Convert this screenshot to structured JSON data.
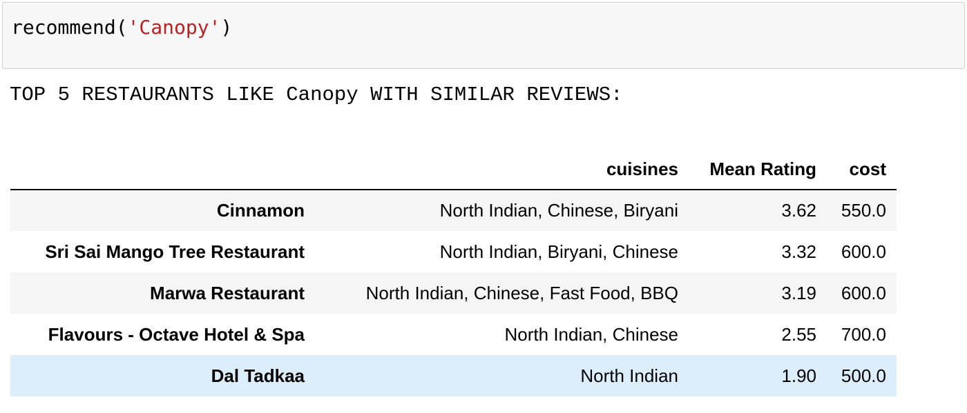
{
  "code_cell": {
    "func": "recommend(",
    "arg": "'Canopy'",
    "close": ")"
  },
  "output": {
    "heading": "TOP 5 RESTAURANTS LIKE Canopy WITH SIMILAR REVIEWS:"
  },
  "table": {
    "columns": [
      "",
      "cuisines",
      "Mean Rating",
      "cost"
    ],
    "rows": [
      {
        "name": "Cinnamon",
        "cuisines": "North Indian, Chinese, Biryani",
        "rating": "3.62",
        "cost": "550.0"
      },
      {
        "name": "Sri Sai Mango Tree Restaurant",
        "cuisines": "North Indian, Biryani, Chinese",
        "rating": "3.32",
        "cost": "600.0"
      },
      {
        "name": "Marwa Restaurant",
        "cuisines": "North Indian, Chinese, Fast Food, BBQ",
        "rating": "3.19",
        "cost": "600.0"
      },
      {
        "name": "Flavours - Octave Hotel & Spa",
        "cuisines": "North Indian, Chinese",
        "rating": "2.55",
        "cost": "700.0"
      },
      {
        "name": "Dal Tadkaa",
        "cuisines": "North Indian",
        "rating": "1.90",
        "cost": "500.0"
      }
    ]
  },
  "colors": {
    "string_token": "#ba2121",
    "cell_background": "#f7f7f7",
    "row_stripe": "#f5f5f5",
    "row_hover": "#dceefb"
  }
}
